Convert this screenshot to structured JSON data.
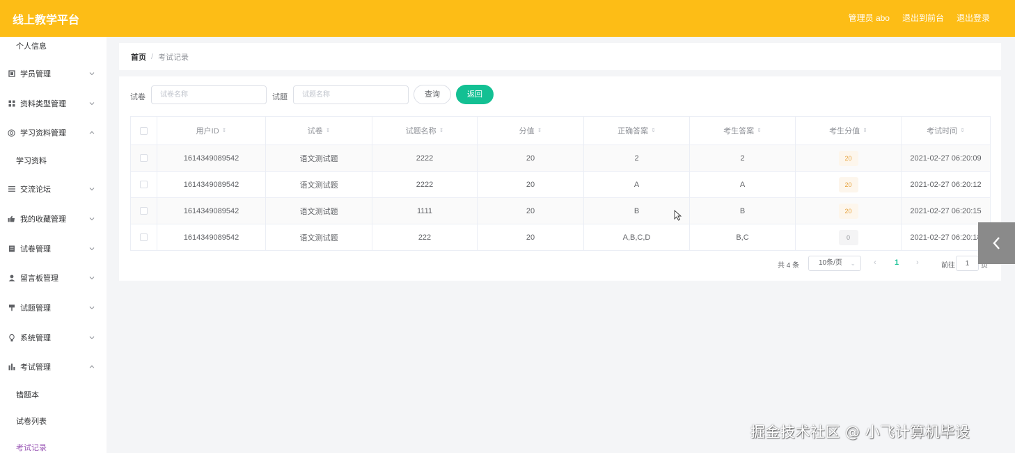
{
  "header": {
    "brand": "线上教学平台",
    "links": [
      "管理员 abo",
      "退出到前台",
      "退出登录"
    ]
  },
  "sidebar": {
    "items": [
      {
        "type": "sub",
        "label": "个人信息"
      },
      {
        "type": "group",
        "label": "学员管理",
        "icon": "building-icon",
        "expanded": false
      },
      {
        "type": "group",
        "label": "资料类型管理",
        "icon": "grid-icon",
        "expanded": false
      },
      {
        "type": "group",
        "label": "学习资料管理",
        "icon": "target-icon",
        "expanded": true
      },
      {
        "type": "sub",
        "label": "学习资料"
      },
      {
        "type": "group",
        "label": "交流论坛",
        "icon": "list-icon",
        "expanded": false
      },
      {
        "type": "group",
        "label": "我的收藏管理",
        "icon": "thumbs-up-icon",
        "expanded": false
      },
      {
        "type": "group",
        "label": "试卷管理",
        "icon": "document-icon",
        "expanded": false
      },
      {
        "type": "group",
        "label": "留言板管理",
        "icon": "user-icon",
        "expanded": false
      },
      {
        "type": "group",
        "label": "试题管理",
        "icon": "pin-icon",
        "expanded": false
      },
      {
        "type": "group",
        "label": "系统管理",
        "icon": "bulb-icon",
        "expanded": false
      },
      {
        "type": "group",
        "label": "考试管理",
        "icon": "bar-chart-icon",
        "expanded": true
      },
      {
        "type": "sub",
        "label": "错题本"
      },
      {
        "type": "sub",
        "label": "试卷列表"
      },
      {
        "type": "sub",
        "label": "考试记录",
        "active": true
      }
    ]
  },
  "breadcrumb": {
    "home": "首页",
    "separator": "/",
    "current": "考试记录"
  },
  "filters": {
    "paper_label": "试卷",
    "paper_placeholder": "试卷名称",
    "question_label": "试题",
    "question_placeholder": "试题名称",
    "query_button": "查询",
    "back_button": "返回"
  },
  "table": {
    "columns": [
      "用户ID",
      "试卷",
      "试题名称",
      "分值",
      "正确答案",
      "考生答案",
      "考生分值",
      "考试时间"
    ],
    "rows": [
      {
        "user_id": "1614349089542",
        "paper": "语文测试题",
        "question": "2222",
        "score": "20",
        "correct": "2",
        "answer": "2",
        "got": "20",
        "time": "2021-02-27 06:20:09"
      },
      {
        "user_id": "1614349089542",
        "paper": "语文测试题",
        "question": "2222",
        "score": "20",
        "correct": "A",
        "answer": "A",
        "got": "20",
        "time": "2021-02-27 06:20:12"
      },
      {
        "user_id": "1614349089542",
        "paper": "语文测试题",
        "question": "1111",
        "score": "20",
        "correct": "B",
        "answer": "B",
        "got": "20",
        "time": "2021-02-27 06:20:15"
      },
      {
        "user_id": "1614349089542",
        "paper": "语文测试题",
        "question": "222",
        "score": "20",
        "correct": "A,B,C,D",
        "answer": "B,C",
        "got": "0",
        "time": "2021-02-27 06:20:18"
      }
    ]
  },
  "pagination": {
    "total": "共 4 条",
    "page_size": "10条/页",
    "current_page": "1",
    "goto_label": "前往",
    "goto_value": "1",
    "goto_unit": "页"
  },
  "watermark": "掘金技术社区 @ 小飞计算机毕设",
  "colors": {
    "topbar": "#fdbd16",
    "accent": "#13c093",
    "active_menu": "#9b59b6"
  }
}
